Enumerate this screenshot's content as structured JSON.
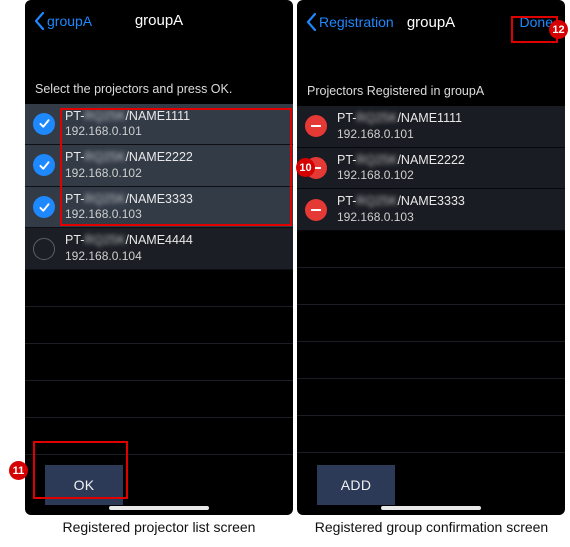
{
  "colors": {
    "accent": "#1e88ff",
    "danger": "#e53935",
    "callout": "#e10000"
  },
  "left": {
    "nav": {
      "back_label": "groupA",
      "title": "groupA"
    },
    "prompt": "Select the projectors and press OK.",
    "projectors": [
      {
        "prefix": "PT-",
        "model_hidden": "RQ25K",
        "name": "/NAME1111",
        "ip": "192.168.0.101",
        "state": "checked"
      },
      {
        "prefix": "PT-",
        "model_hidden": "RQ25K",
        "name": "/NAME2222",
        "ip": "192.168.0.102",
        "state": "checked"
      },
      {
        "prefix": "PT-",
        "model_hidden": "RQ25K",
        "name": "/NAME3333",
        "ip": "192.168.0.103",
        "state": "checked"
      },
      {
        "prefix": "PT-",
        "model_hidden": "RQ25K",
        "name": "/NAME4444",
        "ip": "192.168.0.104",
        "state": "empty"
      }
    ],
    "button": "OK",
    "caption": "Registered projector list screen"
  },
  "right": {
    "nav": {
      "back_label": "Registration",
      "title": "groupA",
      "done": "Done"
    },
    "prompt": "Projectors Registered in groupA",
    "projectors": [
      {
        "prefix": "PT-",
        "model_hidden": "RQ25K",
        "name": "/NAME1111",
        "ip": "192.168.0.101"
      },
      {
        "prefix": "PT-",
        "model_hidden": "RQ25K",
        "name": "/NAME2222",
        "ip": "192.168.0.102"
      },
      {
        "prefix": "PT-",
        "model_hidden": "RQ25K",
        "name": "/NAME3333",
        "ip": "192.168.0.103"
      }
    ],
    "button": "ADD",
    "caption": "Registered group confirmation screen"
  },
  "callouts": {
    "ten": "10",
    "eleven": "11",
    "twelve": "12"
  }
}
